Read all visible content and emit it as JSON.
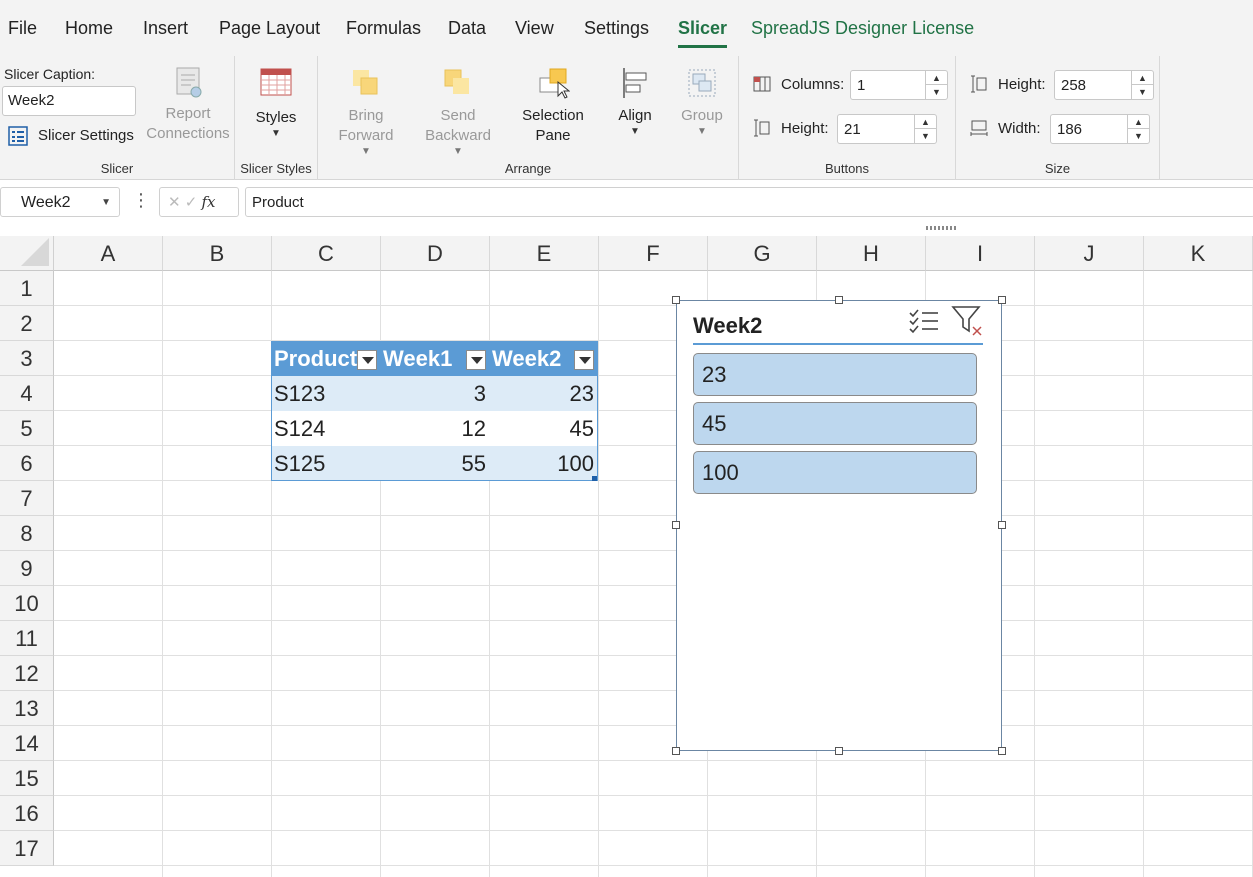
{
  "menu": {
    "tabs": [
      "File",
      "Home",
      "Insert",
      "Page Layout",
      "Formulas",
      "Data",
      "View",
      "Settings",
      "Slicer",
      "SpreadJS Designer License"
    ]
  },
  "ribbon": {
    "slicer_group": {
      "caption_label": "Slicer Caption:",
      "caption_value": "Week2",
      "settings_label": "Slicer Settings",
      "report_connections": [
        "Report",
        "Connections"
      ],
      "group_label": "Slicer"
    },
    "styles_group": {
      "styles_label": "Styles",
      "group_label": "Slicer Styles"
    },
    "arrange_group": {
      "bring_forward": [
        "Bring",
        "Forward"
      ],
      "send_backward": [
        "Send",
        "Backward"
      ],
      "selection_pane": [
        "Selection",
        "Pane"
      ],
      "align": "Align",
      "group": "Group",
      "group_label": "Arrange"
    },
    "buttons_group": {
      "columns_label": "Columns:",
      "columns_value": "1",
      "height_label": "Height:",
      "height_value": "21",
      "group_label": "Buttons"
    },
    "size_group": {
      "height_label": "Height:",
      "height_value": "258",
      "width_label": "Width:",
      "width_value": "186",
      "group_label": "Size"
    }
  },
  "formula_bar": {
    "name_box": "Week2",
    "fx": "fx",
    "content": "Product"
  },
  "sheet": {
    "columns": [
      "A",
      "B",
      "C",
      "D",
      "E",
      "F",
      "G",
      "H",
      "I",
      "J",
      "K"
    ],
    "rows": [
      "1",
      "2",
      "3",
      "4",
      "5",
      "6",
      "7",
      "8",
      "9",
      "10",
      "11",
      "12",
      "13",
      "14",
      "15",
      "16",
      "17"
    ]
  },
  "table": {
    "headers": [
      "Product",
      "Week1",
      "Week2"
    ],
    "rows": [
      [
        "S123",
        "3",
        "23"
      ],
      [
        "S124",
        "12",
        "45"
      ],
      [
        "S125",
        "55",
        "100"
      ]
    ]
  },
  "slicer": {
    "title": "Week2",
    "items": [
      "23",
      "45",
      "100"
    ]
  },
  "icons": {
    "multi_select": "multi-select-icon",
    "clear_filter": "clear-filter-icon"
  },
  "colors": {
    "accent": "#217346",
    "table_header": "#5b9bd5",
    "table_band": "#ddebf7",
    "slicer_item": "#bdd7ee"
  }
}
